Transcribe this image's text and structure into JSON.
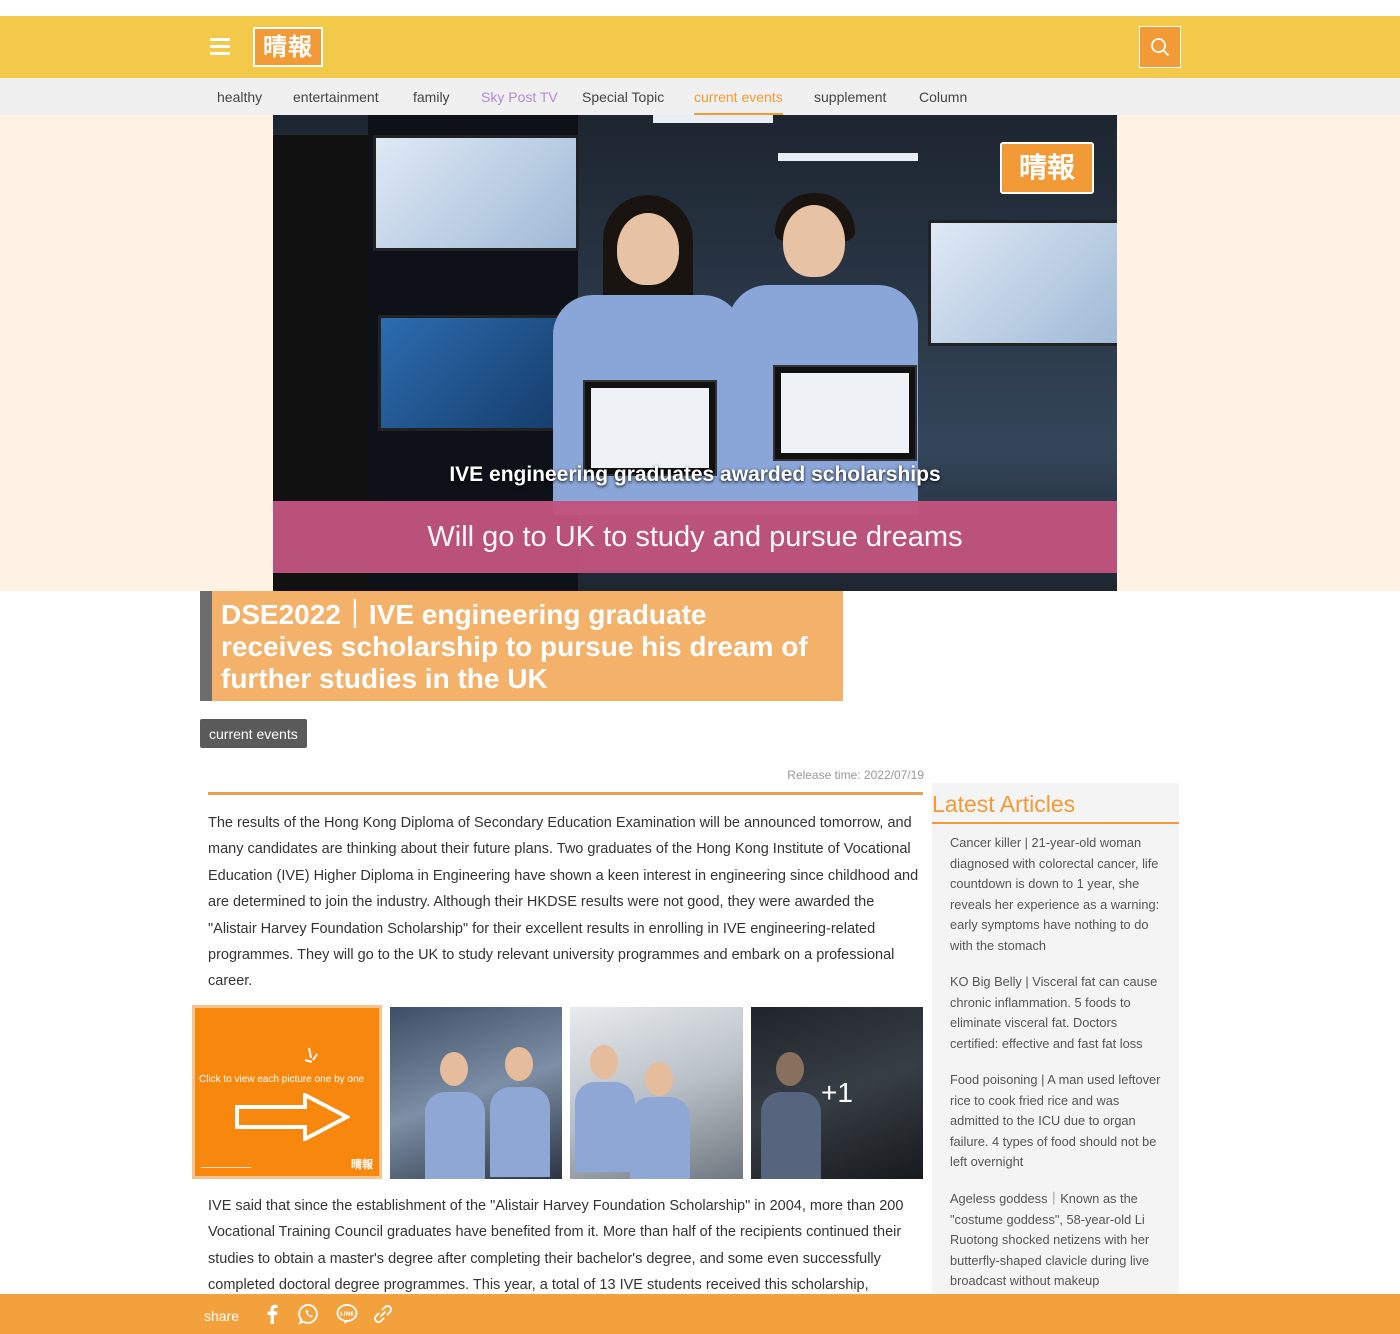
{
  "header": {
    "logo_text": "晴報",
    "brand_color": "#f3c94a",
    "accent_color": "#f29a36"
  },
  "nav": {
    "items": [
      {
        "label": "healthy"
      },
      {
        "label": "entertainment"
      },
      {
        "label": "family"
      },
      {
        "label": "Sky Post TV"
      },
      {
        "label": "Special Topic"
      },
      {
        "label": "current events",
        "active": true
      },
      {
        "label": "supplement"
      },
      {
        "label": "Column"
      }
    ]
  },
  "hero": {
    "logo_text": "晴報",
    "caption_top": "IVE engineering graduates awarded scholarships",
    "caption_band": "Will go to UK to study and pursue dreams"
  },
  "article": {
    "title": "DSE2022｜IVE engineering graduate receives scholarship to pursue his dream of further studies in the UK",
    "category": "current events",
    "release_time": "Release time: 2022/07/19",
    "paragraph1": "The results of the Hong Kong Diploma of Secondary Education Examination will be announced tomorrow, and many candidates are thinking about their future plans. Two graduates of the Hong Kong Institute of Vocational Education (IVE) Higher Diploma in Engineering have shown a keen interest in engineering since childhood and are determined to join the industry. Although their HKDSE results were not good, they were awarded the \"Alistair Harvey Foundation Scholarship\" for their excellent results in enrolling in IVE engineering-related programmes. They will go to the UK to study relevant university programmes and embark on a professional career.",
    "paragraph2": "IVE said that since the establishment of the \"Alistair Harvey Foundation Scholarship\" in 2004, more than 200 Vocational Training Council graduates have benefited from it. More than half of the recipients continued their studies to obtain a master's degree after completing their bachelor's degree, and some even successfully completed doctoral degree programmes. This year, a total of 13 IVE students received this scholarship,"
  },
  "gallery": {
    "hint": "Click to view each picture one by one",
    "logo_text": "晴報",
    "more_count": "+1"
  },
  "sidebar": {
    "title": "Latest Articles",
    "items": [
      {
        "text": "Cancer killer | 21-year-old woman diagnosed with colorectal cancer, life countdown is down to 1 year, she reveals her experience as a warning: early symptoms have nothing to do with the stomach"
      },
      {
        "text": "KO Big Belly | Visceral fat can cause chronic inflammation. 5 foods to eliminate visceral fat. Doctors certified: effective and fast fat loss"
      },
      {
        "text": "Food poisoning | A man used leftover rice to cook fried rice and was admitted to the ICU due to organ failure. 4 types of food should not be left overnight"
      },
      {
        "text": "Ageless goddess｜Known as the \"costume goddess\", 58-year-old Li Ruotong shocked netizens with her butterfly-shaped clavicle during live broadcast without makeup"
      }
    ]
  },
  "share": {
    "label": "share",
    "icons": [
      "facebook-icon",
      "whatsapp-icon",
      "line-icon",
      "link-icon"
    ]
  }
}
